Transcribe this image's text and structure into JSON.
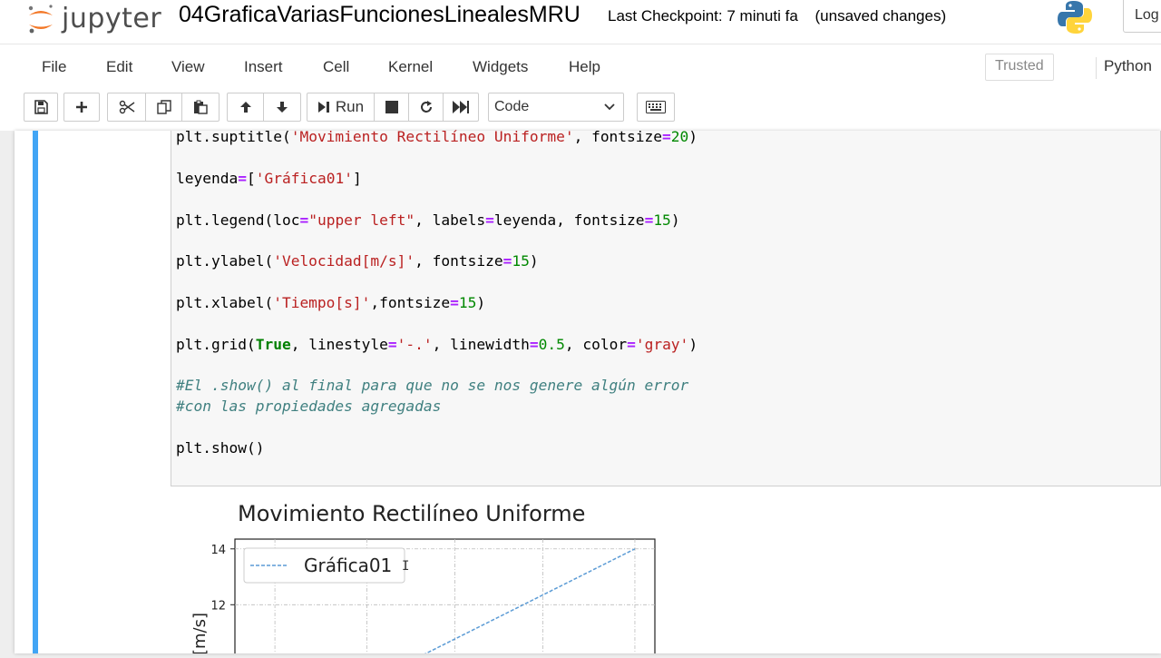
{
  "header": {
    "logo_text": "jupyter",
    "notebook_title": "04GraficaVariasFuncionesLinealesMRU",
    "checkpoint": "Last Checkpoint: 7 minuti fa",
    "status": "(unsaved changes)",
    "logout_label": "Log"
  },
  "menu": {
    "items": [
      "File",
      "Edit",
      "View",
      "Insert",
      "Cell",
      "Kernel",
      "Widgets",
      "Help"
    ],
    "trusted": "Trusted",
    "kernel": "Python"
  },
  "toolbar": {
    "run_label": "Run",
    "cell_type": "Code"
  },
  "code": {
    "line1": {
      "fn": "plt.suptitle(",
      "s1": "'Movimiento Rectilíneo Uniforme'",
      "rest": ", fontsize",
      "eq": "=",
      "n": "20",
      "end": ")"
    },
    "line2": {
      "a": "leyenda",
      "eq": "=",
      "b": "[",
      "s": "'Gráfica01'",
      "c": "]"
    },
    "line3": {
      "fn": "plt.legend(loc",
      "eq1": "=",
      "s": "\"upper left\"",
      "mid": ", labels",
      "eq2": "=",
      "mid2": "leyenda, fontsize",
      "eq3": "=",
      "n": "15",
      "end": ")"
    },
    "line4": {
      "fn": "plt.ylabel(",
      "s": "'Velocidad[m/s]'",
      "mid": ", fontsize",
      "eq": "=",
      "n": "15",
      "end": ")"
    },
    "line5": {
      "fn": "plt.xlabel(",
      "s": "'Tiempo[s]'",
      "mid": ",fontsize",
      "eq": "=",
      "n": "15",
      "end": ")"
    },
    "line6": {
      "fn": "plt.grid(",
      "kw": "True",
      "m1": ", linestyle",
      "eq1": "=",
      "s1": "'-.'",
      "m2": ", linewidth",
      "eq2": "=",
      "n": "0.5",
      "m3": ", color",
      "eq3": "=",
      "s2": "'gray'",
      "end": ")"
    },
    "comment1": "#El .show() al final para que no se nos genere algún error",
    "comment2": "#con las propiedades agregadas",
    "line7": "plt.show()"
  },
  "chart_data": {
    "type": "line",
    "title": "Movimiento Rectilíneo Uniforme",
    "ylabel": "[m/s]",
    "yticks": [
      12,
      14
    ],
    "legend": {
      "position": "upper left",
      "entries": [
        "Gráfica01"
      ]
    },
    "series": [
      {
        "name": "Gráfica01",
        "x": [
          4.7,
          10
        ],
        "y": [
          10.2,
          14
        ],
        "color": "#5b9bd5",
        "style": "dashed"
      }
    ],
    "grid": true,
    "visible_ylim": [
      10.2,
      14.3
    ]
  }
}
